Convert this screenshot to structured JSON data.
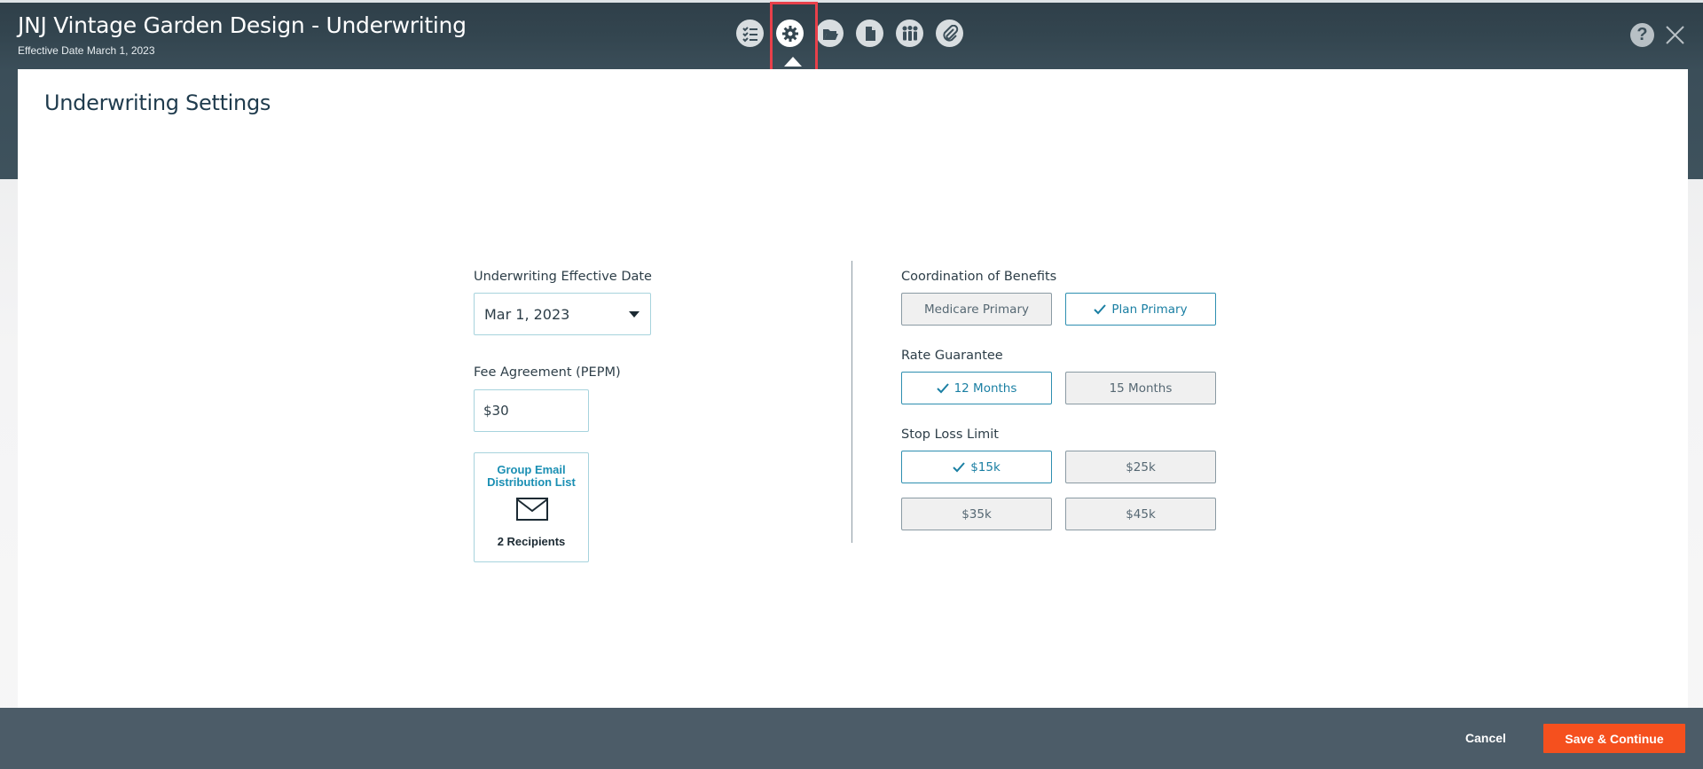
{
  "header": {
    "title": "JNJ Vintage Garden Design - Underwriting",
    "subtitle": "Effective Date March 1, 2023",
    "toolbar_icons": [
      "checklist-icon",
      "gear-icon",
      "folder-open-icon",
      "document-icon",
      "people-icon",
      "paperclip-icon"
    ],
    "active_icon": "gear-icon",
    "help_label": "?"
  },
  "panel": {
    "title": "Underwriting Settings",
    "left": {
      "effective_date_label": "Underwriting Effective Date",
      "effective_date_value": "Mar 1, 2023",
      "fee_label": "Fee Agreement (PEPM)",
      "fee_value": "$30",
      "email_card": {
        "title": "Group Email Distribution List",
        "icon": "envelope-icon",
        "count": "2 Recipients"
      }
    },
    "right": {
      "coordination_label": "Coordination of Benefits",
      "coordination_options": [
        {
          "label": "Medicare Primary",
          "selected": false
        },
        {
          "label": "Plan Primary",
          "selected": true
        }
      ],
      "rate_label": "Rate Guarantee",
      "rate_options": [
        {
          "label": "12 Months",
          "selected": true
        },
        {
          "label": "15 Months",
          "selected": false
        }
      ],
      "stoploss_label": "Stop Loss Limit",
      "stoploss_options": [
        {
          "label": "$15k",
          "selected": true
        },
        {
          "label": "$25k",
          "selected": false
        },
        {
          "label": "$35k",
          "selected": false
        },
        {
          "label": "$45k",
          "selected": false
        }
      ]
    }
  },
  "footer": {
    "cancel_label": "Cancel",
    "save_label": "Save & Continue"
  },
  "colors": {
    "accent": "#1a8fb3",
    "primary_button": "#f5501e",
    "header_bg": "#33454f",
    "footer_bg": "#4c5c68",
    "highlight": "#e8404a"
  }
}
